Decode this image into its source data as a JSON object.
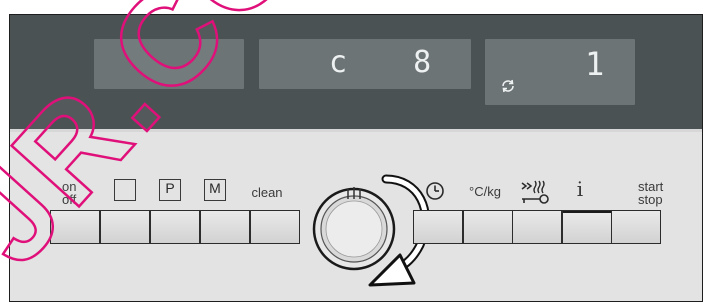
{
  "displays": {
    "program_code": "c  8",
    "value": "1"
  },
  "left_panel": {
    "on_off": {
      "line1": "on",
      "line2": "off"
    },
    "p_label": "P",
    "m_label": "M",
    "clean_label": "clean"
  },
  "right_panel": {
    "temp_unit_label": "°C/kg",
    "info_label": "i",
    "start_stop": {
      "line1": "start",
      "line2": "stop"
    }
  },
  "icons": {
    "knob": "rotary-knob-icon",
    "rotate": "clockwise-arrow-icon",
    "clock": "clock-icon",
    "lock": "key-lock-icon",
    "refresh": "cycle-icon"
  },
  "watermark": {
    "text": "JR.CO",
    "color": "#e0107a"
  },
  "colors": {
    "display_band": "#4b5253",
    "display_window": "#6d7475",
    "panel": "#e3e3e3"
  }
}
